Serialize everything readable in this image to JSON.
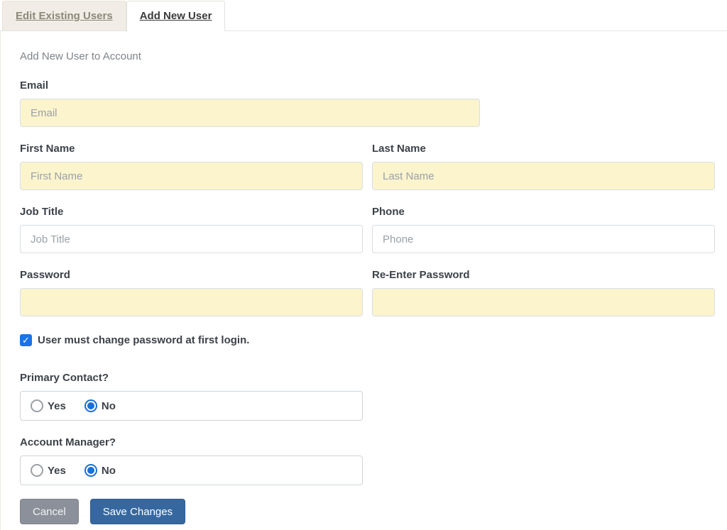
{
  "tabs": {
    "edit_existing": "Edit Existing Users",
    "add_new": "Add New User"
  },
  "form": {
    "heading": "Add New User to Account",
    "fields": {
      "email": {
        "label": "Email",
        "placeholder": "Email",
        "value": ""
      },
      "first_name": {
        "label": "First Name",
        "placeholder": "First Name",
        "value": ""
      },
      "last_name": {
        "label": "Last Name",
        "placeholder": "Last Name",
        "value": ""
      },
      "job_title": {
        "label": "Job Title",
        "placeholder": "Job Title",
        "value": ""
      },
      "phone": {
        "label": "Phone",
        "placeholder": "Phone",
        "value": ""
      },
      "password": {
        "label": "Password",
        "placeholder": "",
        "value": ""
      },
      "reenter_password": {
        "label": "Re-Enter Password",
        "placeholder": "",
        "value": ""
      }
    },
    "change_password_checkbox": {
      "label": "User must change password at first login.",
      "checked": true
    },
    "primary_contact": {
      "label": "Primary Contact?",
      "options": [
        "Yes",
        "No"
      ],
      "selected": "No"
    },
    "account_manager": {
      "label": "Account Manager?",
      "options": [
        "Yes",
        "No"
      ],
      "selected": "No"
    },
    "buttons": {
      "cancel_label": "Cancel",
      "save_label": "Save Changes"
    }
  },
  "icons": {
    "checkmark": "✓"
  },
  "colors": {
    "highlight_input_bg": "#FBF4CD",
    "accent_blue": "#1A73E8",
    "save_button": "#36689F",
    "cancel_button": "#8B909A",
    "inactive_tab_bg": "#F1EDE6"
  }
}
